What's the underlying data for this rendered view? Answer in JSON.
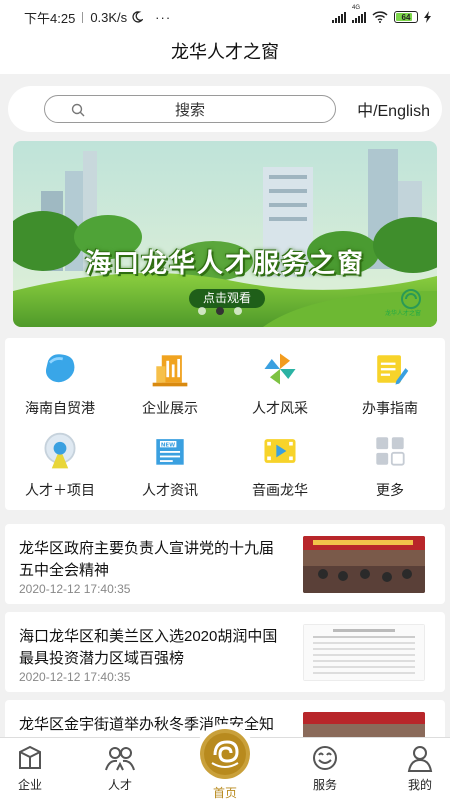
{
  "status_bar": {
    "time": "下午4:25",
    "speed": "0.3K/s",
    "more": "···",
    "network": "4G",
    "battery": "64"
  },
  "header": {
    "title": "龙华人才之窗"
  },
  "search": {
    "placeholder": "搜索",
    "lang_toggle": "中/English"
  },
  "banner": {
    "title": "海口龙华人才服务之窗",
    "button": "点击观看",
    "logo_text": "龙华人才之窗",
    "slide_count": 3,
    "active_slide": 2
  },
  "grid": {
    "items": [
      {
        "label": "海南自贸港",
        "icon": "hainan-map-icon"
      },
      {
        "label": "企业展示",
        "icon": "building-chart-icon"
      },
      {
        "label": "人才风采",
        "icon": "pinwheel-icon"
      },
      {
        "label": "办事指南",
        "icon": "notepad-pencil-icon"
      },
      {
        "label": "人才＋项目",
        "icon": "location-pin-icon"
      },
      {
        "label": "人才资讯",
        "icon": "newspaper-icon"
      },
      {
        "label": "音画龙华",
        "icon": "film-play-icon"
      },
      {
        "label": "更多",
        "icon": "more-grid-icon"
      }
    ]
  },
  "news": [
    {
      "title": "龙华区政府主要负责人宣讲党的十九届五中全会精神",
      "date": "2020-12-12 17:40:35"
    },
    {
      "title": "海口龙华区和美兰区入选2020胡润中国最具投资潜力区域百强榜",
      "date": "2020-12-12 17:40:35"
    },
    {
      "title": "龙华区金宇街道举办秋冬季消防安全知",
      "date": ""
    }
  ],
  "tabbar": {
    "items": [
      {
        "label": "企业",
        "icon": "enterprise-icon"
      },
      {
        "label": "人才",
        "icon": "people-icon"
      },
      {
        "label": "首页",
        "icon": "home-logo-icon",
        "active": true
      },
      {
        "label": "服务",
        "icon": "smile-service-icon"
      },
      {
        "label": "我的",
        "icon": "user-icon"
      }
    ]
  },
  "colors": {
    "accent_gold": "#b88a1e",
    "banner_green": "#4f9a2a",
    "background": "#f1f1f1"
  }
}
